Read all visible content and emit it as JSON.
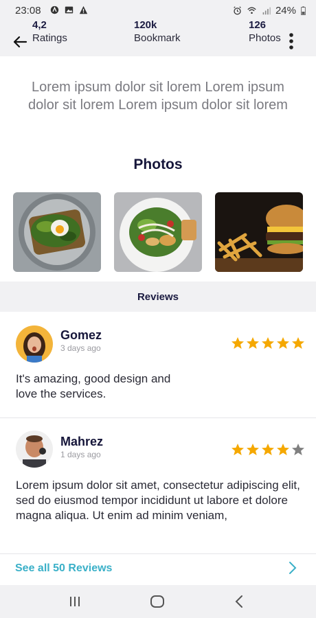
{
  "status_bar": {
    "time": "23:08",
    "battery": "24%"
  },
  "stats": [
    {
      "value": "4,2",
      "label": "Ratings"
    },
    {
      "value": "120k",
      "label": "Bookmark"
    },
    {
      "value": "126",
      "label": "Photos"
    }
  ],
  "intro_text": "Lorem ipsum dolor sit lorem Lorem ipsum dolor sit lorem Lorem ipsum dolor sit lorem",
  "photos_title": "Photos",
  "photos": [
    {
      "icon": "avocado-toast-photo"
    },
    {
      "icon": "salad-photo"
    },
    {
      "icon": "burger-fries-photo"
    }
  ],
  "reviews_header": "Reviews",
  "reviews": [
    {
      "name": "Gomez",
      "time": "3 days ago",
      "rating": 5,
      "text": "It's amazing, good design and love the services."
    },
    {
      "name": "Mahrez",
      "time": "1 days ago",
      "rating": 4,
      "text": "Lorem ipsum dolor sit amet, consectetur adipiscing elit, sed do eiusmod tempor incididunt ut labore et dolore magna aliqua. Ut enim ad minim veniam,"
    }
  ],
  "see_all": "See all 50 Reviews",
  "colors": {
    "star_filled": "#f5a800",
    "star_empty": "#808080",
    "accent": "#3ab0c8",
    "title": "#16163a"
  }
}
